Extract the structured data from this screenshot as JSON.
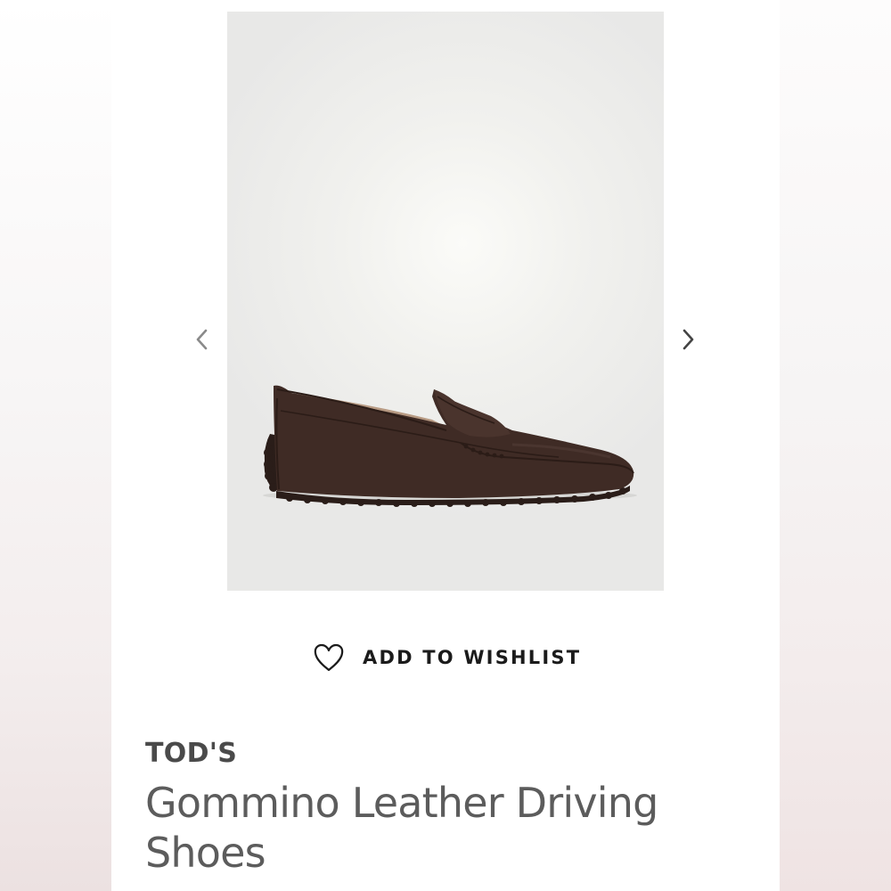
{
  "product": {
    "brand": "TOD'S",
    "name": "Gommino Leather Driving Shoes",
    "image_description_icon": "brown-leather-loafer-image",
    "image_bg_color": "#eaeae8",
    "shoe_color": "#3d2a24"
  },
  "gallery": {
    "prev_icon": "chevron-left-icon",
    "next_icon": "chevron-right-icon",
    "arrow_color_prev": "#8a8a8a",
    "arrow_color_next": "#444444"
  },
  "wishlist": {
    "label": "ADD TO WISHLIST",
    "icon": "heart-icon"
  }
}
